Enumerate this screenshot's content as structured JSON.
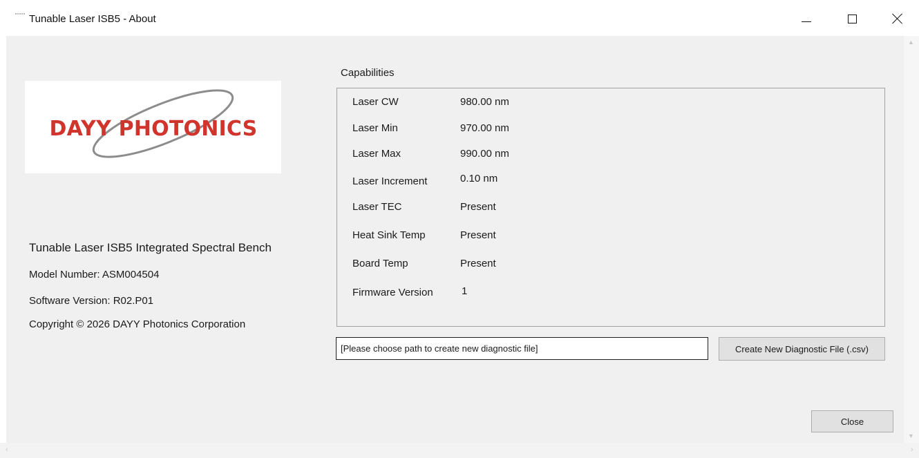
{
  "window": {
    "title": "Tunable Laser ISB5 - About",
    "minimize_icon": "minimize-icon",
    "maximize_icon": "maximize-icon",
    "close_icon": "close-icon"
  },
  "logo": {
    "text": "DAYY PHOTONICS",
    "text_color": "#d0342c",
    "swoosh_color": "#8c8c8c"
  },
  "product": {
    "name": "Tunable Laser ISB5 Integrated Spectral Bench",
    "model": "Model Number: ASM004504",
    "software": "Software Version: R02.P01",
    "copyright": "Copyright © 2026 DAYY Photonics Corporation"
  },
  "capabilities": {
    "label": "Capabilities",
    "rows": [
      {
        "key": "Laser CW",
        "value": "980.00 nm"
      },
      {
        "key": "Laser Min",
        "value": "970.00 nm"
      },
      {
        "key": "Laser Max",
        "value": "990.00 nm"
      },
      {
        "key": "Laser Increment",
        "value": "0.10 nm"
      },
      {
        "key": "Laser TEC",
        "value": "Present"
      },
      {
        "key": "Heat Sink Temp",
        "value": "Present"
      },
      {
        "key": "Board Temp",
        "value": "Present"
      },
      {
        "key": "Firmware Version",
        "value": "1"
      }
    ]
  },
  "diagnostic": {
    "path_value": "[Please choose path to create new diagnostic file]",
    "create_button": "Create New Diagnostic File (.csv)"
  },
  "footer": {
    "close_button": "Close"
  }
}
